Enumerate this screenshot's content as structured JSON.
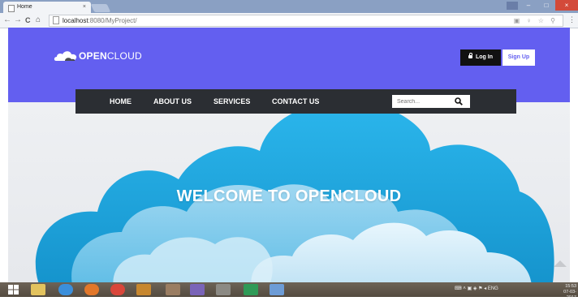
{
  "browser": {
    "tab_title": "Home",
    "tab_close": "×",
    "url_host": "localhost",
    "url_path": ":8080/MyProject/",
    "back": "←",
    "forward": "→",
    "reload": "C",
    "home": "⌂",
    "menu": "⋮"
  },
  "window_controls": {
    "minimize": "–",
    "maximize": "□",
    "close": "×"
  },
  "site": {
    "logo_bold": "OPEN",
    "logo_light": "CLOUD",
    "login_label": "Log In",
    "signup_label": "Sign Up",
    "nav": [
      "HOME",
      "ABOUT US",
      "SERVICES",
      "CONTACT US"
    ],
    "search_placeholder": "Search...",
    "hero_title": "WELCOME TO OPENCLOUD"
  },
  "taskbar": {
    "tray_lang": "ENG",
    "time": "15:53",
    "date": "07-03-2017"
  },
  "colors": {
    "header": "#635ff0",
    "navbar": "#2b2e33",
    "cloud_primary": "#1fa7e0",
    "cloud_secondary": "#d7eef9"
  }
}
